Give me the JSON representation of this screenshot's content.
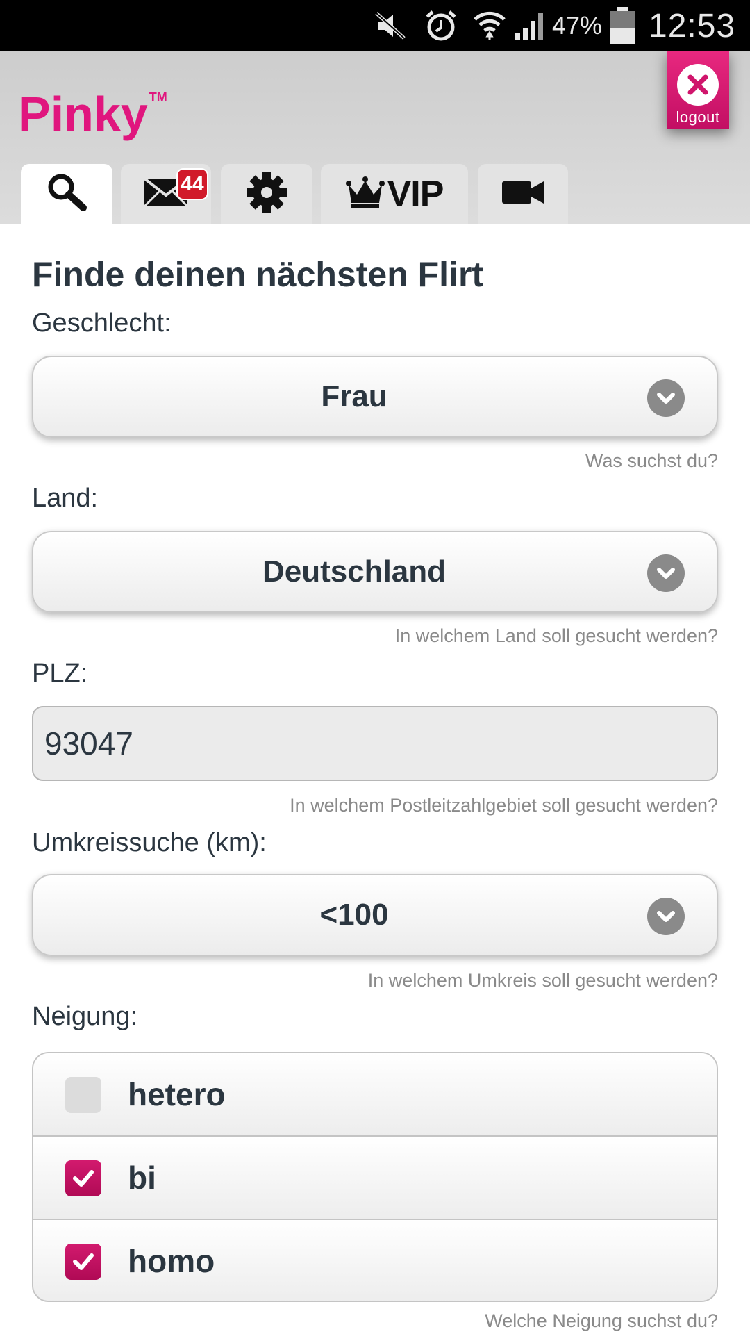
{
  "status_bar": {
    "icons": [
      "mute-icon",
      "alarm-icon",
      "wifi-icon",
      "signal-icon",
      "battery-icon"
    ],
    "battery": "47%",
    "time": "12:53"
  },
  "header": {
    "brand": "Pinky",
    "trademark": "TM",
    "logout_label": "logout",
    "brand_color": "#e0167e",
    "tabs": [
      {
        "icon": "search-icon",
        "active": true
      },
      {
        "icon": "mail-icon",
        "badge": "44"
      },
      {
        "icon": "gear-icon"
      },
      {
        "icon": "crown-icon",
        "label": "VIP"
      },
      {
        "icon": "video-camera-icon"
      }
    ]
  },
  "form": {
    "title": "Finde deinen nächsten Flirt",
    "gender": {
      "label": "Geschlecht:",
      "value": "Frau",
      "hint": "Was suchst du?"
    },
    "country": {
      "label": "Land:",
      "value": "Deutschland",
      "hint": "In welchem Land soll gesucht werden?"
    },
    "zip": {
      "label": "PLZ:",
      "value": "93047",
      "hint": "In welchem Postleitzahlgebiet soll gesucht werden?"
    },
    "radius": {
      "label": "Umkreissuche (km):",
      "value": "<100",
      "hint": "In welchem Umkreis soll gesucht werden?"
    },
    "orientation": {
      "label": "Neigung:",
      "options": [
        {
          "label": "hetero",
          "checked": false
        },
        {
          "label": "bi",
          "checked": true
        },
        {
          "label": "homo",
          "checked": true
        }
      ],
      "hint": "Welche Neigung suchst du?"
    }
  }
}
